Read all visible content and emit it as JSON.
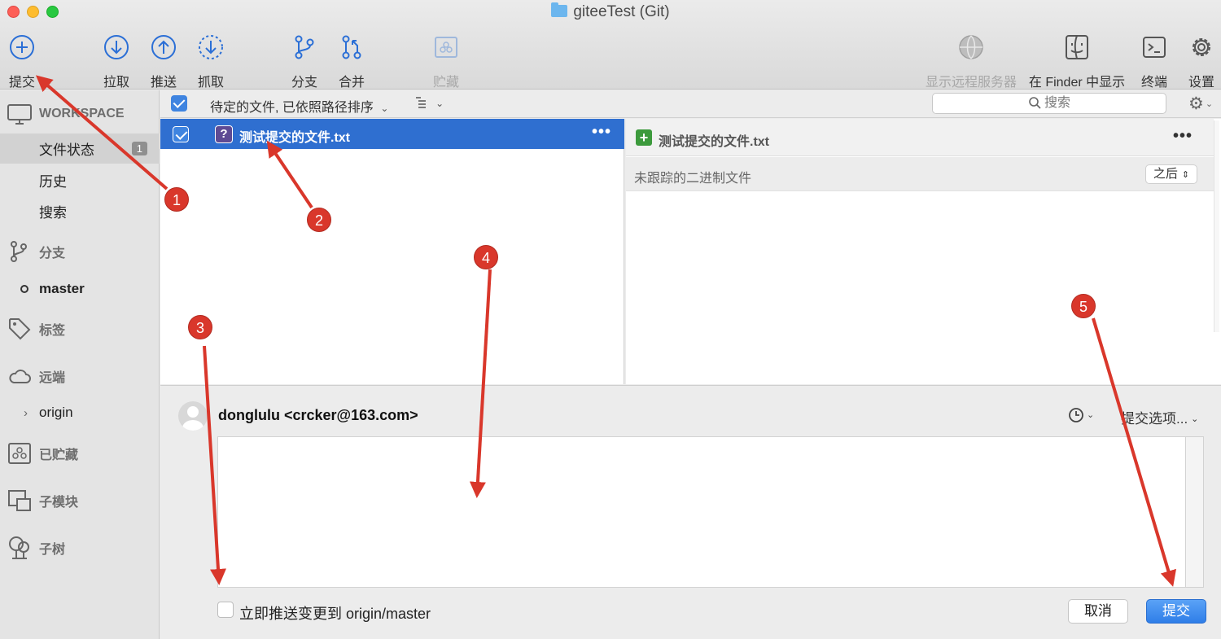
{
  "window": {
    "title": "giteeTest (Git)",
    "folder_icon": "folder-icon"
  },
  "toolbar": {
    "commit": "提交",
    "pull": "拉取",
    "push": "推送",
    "fetch": "抓取",
    "branch": "分支",
    "merge": "合并",
    "stash": "贮藏",
    "remote_server": "显示远程服务器",
    "show_in_finder": "在 Finder 中显示",
    "terminal": "终端",
    "settings": "设置"
  },
  "sidebar": {
    "workspace_header": "WORKSPACE",
    "file_status": "文件状态",
    "file_status_count": "1",
    "history": "历史",
    "search": "搜索",
    "branches_header": "分支",
    "current_branch": "master",
    "tags_header": "标签",
    "remotes_header": "远端",
    "remote_origin": "origin",
    "stashes_header": "已贮藏",
    "submodules_header": "子模块",
    "subtrees_header": "子树"
  },
  "file_list": {
    "header_label": "待定的文件, 已依照路径排序",
    "search_placeholder": "搜索",
    "files": [
      {
        "name": "测试提交的文件.txt",
        "status": "untracked",
        "staged": true
      }
    ]
  },
  "diff": {
    "file_name": "测试提交的文件.txt",
    "subtitle": "未跟踪的二进制文件",
    "view_mode": "之后"
  },
  "commit": {
    "author": "donglulu <crcker@163.com>",
    "options_label": "提交选项...",
    "message": "",
    "push_immediately_label": "立即推送变更到 origin/master",
    "push_immediately_checked": false,
    "cancel_label": "取消",
    "commit_label": "提交"
  },
  "annotations": {
    "markers": [
      "1",
      "2",
      "3",
      "4",
      "5"
    ],
    "color": "#d9372b"
  },
  "colors": {
    "selection_blue": "#2f6fd0",
    "primary_button": "#3f8ef0"
  }
}
